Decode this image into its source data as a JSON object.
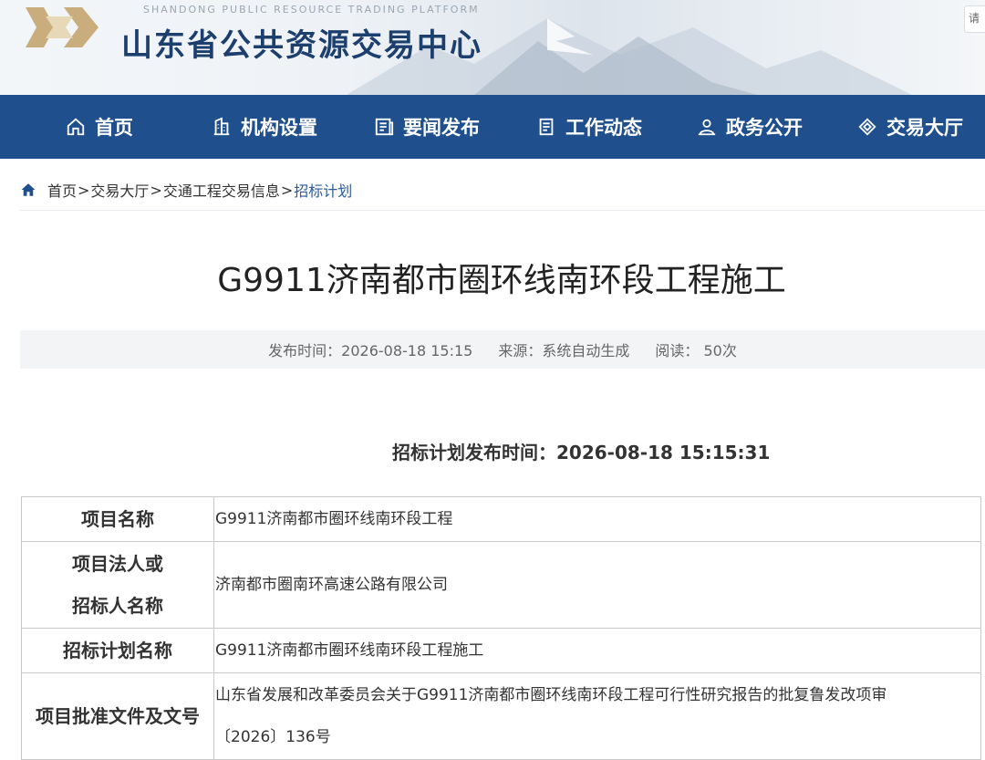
{
  "header": {
    "subtitle": "SHANDONG PUBLIC RESOURCE TRADING PLATFORM",
    "title": "山东省公共资源交易中心",
    "search_corner": "请"
  },
  "nav": {
    "items": [
      {
        "label": "首页",
        "icon": "home-icon"
      },
      {
        "label": "机构设置",
        "icon": "building-icon"
      },
      {
        "label": "要闻发布",
        "icon": "news-icon"
      },
      {
        "label": "工作动态",
        "icon": "document-icon"
      },
      {
        "label": "政务公开",
        "icon": "people-icon"
      },
      {
        "label": "交易大厅",
        "icon": "diamond-icon"
      }
    ],
    "accent_color": "#1f4f8d"
  },
  "breadcrumb": {
    "items": [
      "首页",
      "交易大厅",
      "交通工程交易信息"
    ],
    "current": "招标计划",
    "separator": ">"
  },
  "article": {
    "title": "G9911济南都市圈环线南环段工程施工",
    "meta": {
      "publish_time": "发布时间：2026-08-18 15:15",
      "source": "来源：系统自动生成",
      "views": "阅读： 50次"
    },
    "publish_line": "招标计划发布时间：2026-08-18 15:15:31"
  },
  "table": {
    "rows": [
      {
        "label": "项目名称",
        "value": "G9911济南都市圈环线南环段工程"
      },
      {
        "label_line1": "项目法人或",
        "label_line2": "招标人名称",
        "value": "济南都市圈南环高速公路有限公司"
      },
      {
        "label": "招标计划名称",
        "value": "G9911济南都市圈环线南环段工程施工"
      },
      {
        "label": "项目批准文件及文号",
        "value_line1": "山东省发展和改革委员会关于G9911济南都市圈环线南环段工程可行性研究报告的批复鲁发改项审",
        "value_line2": "〔2026〕136号"
      }
    ]
  }
}
